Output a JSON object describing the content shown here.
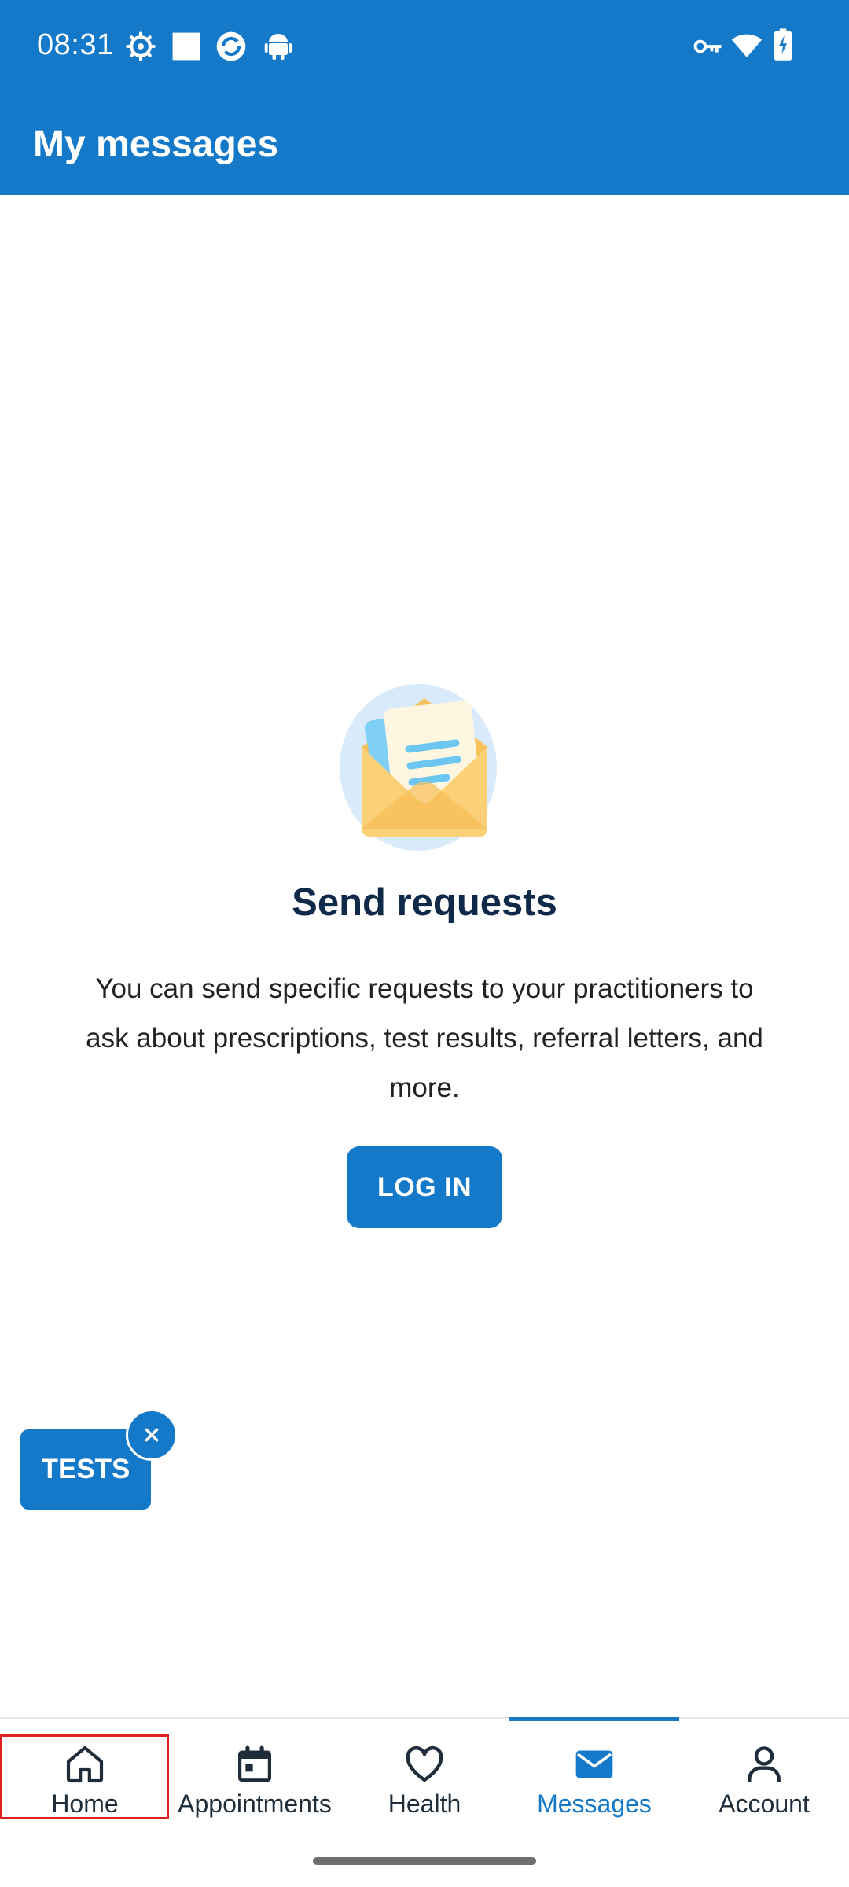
{
  "status_bar": {
    "time": "08:31",
    "icons": [
      "settings-gear-icon",
      "square-icon",
      "sync-icon",
      "android-icon",
      "vpn-key-icon",
      "wifi-icon",
      "battery-charging-icon"
    ]
  },
  "app_bar": {
    "title": "My messages"
  },
  "empty_state": {
    "illustration": "open-envelope-letter-icon",
    "title": "Send requests",
    "body": "You can send specific requests to your practitioners to ask about prescriptions, test results, referral letters, and more.",
    "button_label": "LOG IN"
  },
  "tests_badge": {
    "label": "TESTS",
    "close_icon": "close-icon"
  },
  "bottom_nav": {
    "items": [
      {
        "label": "Home",
        "icon": "home-icon",
        "active": false
      },
      {
        "label": "Appointments",
        "icon": "calendar-icon",
        "active": false
      },
      {
        "label": "Health",
        "icon": "heart-icon",
        "active": false
      },
      {
        "label": "Messages",
        "icon": "mail-icon",
        "active": true
      },
      {
        "label": "Account",
        "icon": "person-icon",
        "active": false
      }
    ]
  },
  "colors": {
    "primary": "#1479c9",
    "title_dark": "#0f2a48",
    "highlight_red": "#e02020"
  }
}
